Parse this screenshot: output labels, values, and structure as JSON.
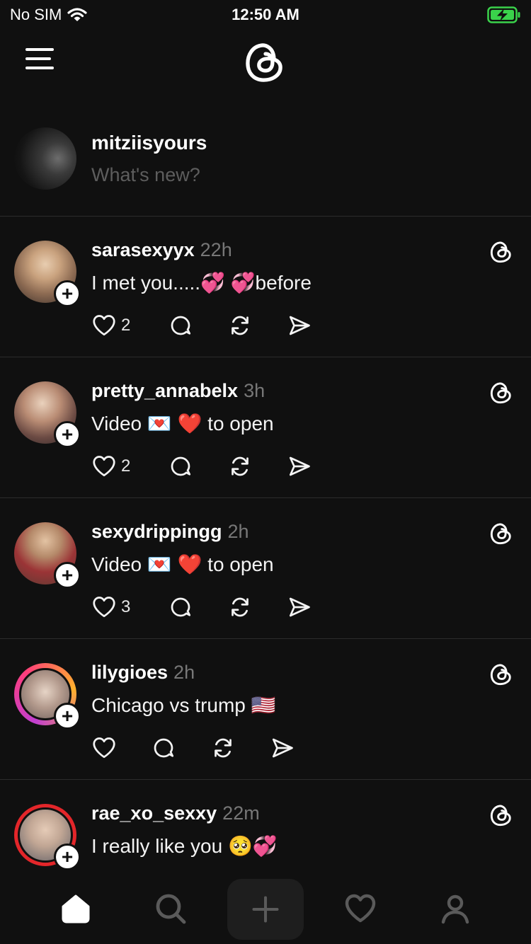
{
  "status_bar": {
    "carrier": "No SIM",
    "time": "12:50 AM",
    "battery_color": "#3ad24b"
  },
  "nav": {
    "menu_icon": "menu-icon",
    "logo_icon": "threads-logo-icon"
  },
  "composer": {
    "username": "mitziisyours",
    "placeholder": "What's new?"
  },
  "posts": [
    {
      "username": "sarasexyyx",
      "time": "22h",
      "text": "I met you.....💞 💞before",
      "likes": "2",
      "avatar_ring": "none"
    },
    {
      "username": "pretty_annabelx",
      "time": "3h",
      "text": "Video 💌 ❤️ to open",
      "likes": "2",
      "avatar_ring": "none"
    },
    {
      "username": "sexydrippingg",
      "time": "2h",
      "text": "Video 💌 ❤️ to open",
      "likes": "3",
      "avatar_ring": "none"
    },
    {
      "username": "lilygioes",
      "time": "2h",
      "text": "Chicago vs trump 🇺🇸",
      "likes": "",
      "avatar_ring": "gradient"
    },
    {
      "username": "rae_xo_sexxy",
      "time": "22m",
      "text": "I really like you 🥺💞",
      "likes": "",
      "avatar_ring": "red"
    }
  ],
  "tabs": [
    "home-icon",
    "search-icon",
    "compose-plus-icon",
    "activity-heart-icon",
    "profile-icon"
  ],
  "colors": {
    "background": "#101010",
    "divider": "#2c2c2c",
    "muted": "#777777",
    "placeholder": "#5d5d5d"
  }
}
